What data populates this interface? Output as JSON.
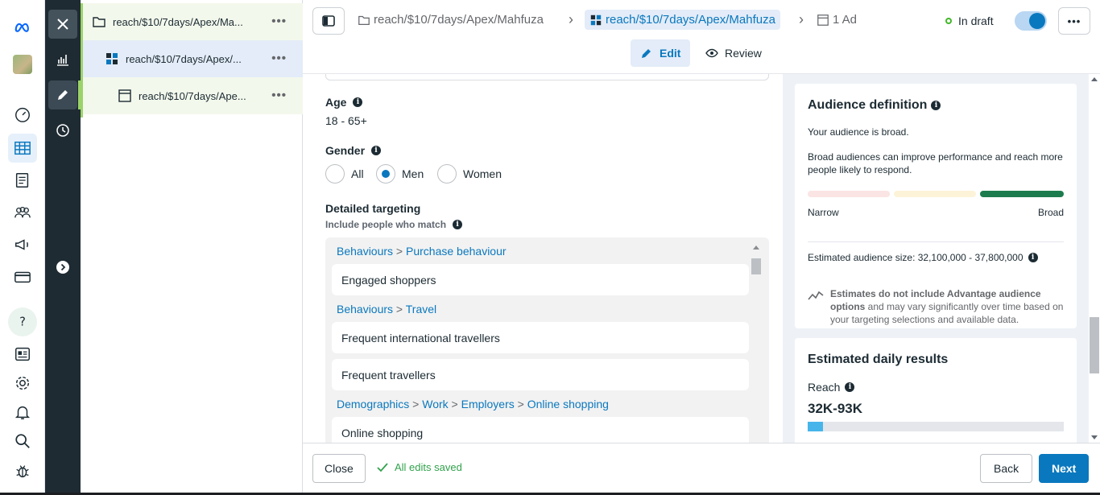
{
  "tree": {
    "campaign": "reach/$10/7days/Apex/Ma...",
    "adset": "reach/$10/7days/Apex/...",
    "ad": "reach/$10/7days/Ape...",
    "more": "•••"
  },
  "header": {
    "crumb_campaign": "reach/$10/7days/Apex/Mahfuza",
    "crumb_adset": "reach/$10/7days/Apex/Mahfuza",
    "crumb_ad": "1 Ad",
    "status": "In draft",
    "more": "•••",
    "tab_edit": "Edit",
    "tab_review": "Review"
  },
  "form": {
    "age_label": "Age",
    "age_value": "18 - 65+",
    "gender_label": "Gender",
    "gender_options": [
      "All",
      "Men",
      "Women"
    ],
    "gender_selected": "Men",
    "targeting_label": "Detailed targeting",
    "targeting_sub": "Include people who match",
    "groups": [
      {
        "path": [
          "Behaviours",
          "Purchase behaviour"
        ],
        "items": [
          "Engaged shoppers"
        ]
      },
      {
        "path": [
          "Behaviours",
          "Travel"
        ],
        "items": [
          "Frequent international travellers",
          "Frequent travellers"
        ]
      },
      {
        "path": [
          "Demographics",
          "Work",
          "Employers",
          "Online shopping"
        ],
        "items": [
          "Online shopping"
        ]
      }
    ]
  },
  "audience": {
    "title": "Audience definition",
    "broad_text": "Your audience is broad.",
    "desc": "Broad audiences can improve performance and reach more people likely to respond.",
    "narrow": "Narrow",
    "broad": "Broad",
    "estimated_size": "Estimated audience size: 32,100,000 - 37,800,000",
    "note_bold": "Estimates do not include Advantage audience options",
    "note_rest": " and may vary significantly over time based on your targeting selections and available data.",
    "meter_colors": [
      "#fbe4e4",
      "#fdf3d8",
      "#1d7c4d"
    ]
  },
  "results": {
    "title": "Estimated daily results",
    "reach_label": "Reach",
    "reach_value": "32K-93K",
    "reach_fraction": 0.06
  },
  "footer": {
    "close": "Close",
    "saved": "All edits saved",
    "back": "Back",
    "next": "Next"
  },
  "colors": {
    "accent": "#0a78be",
    "success": "#31a24c",
    "dark_strip": "#1f2b33",
    "tree_green": "#9bd36a"
  }
}
